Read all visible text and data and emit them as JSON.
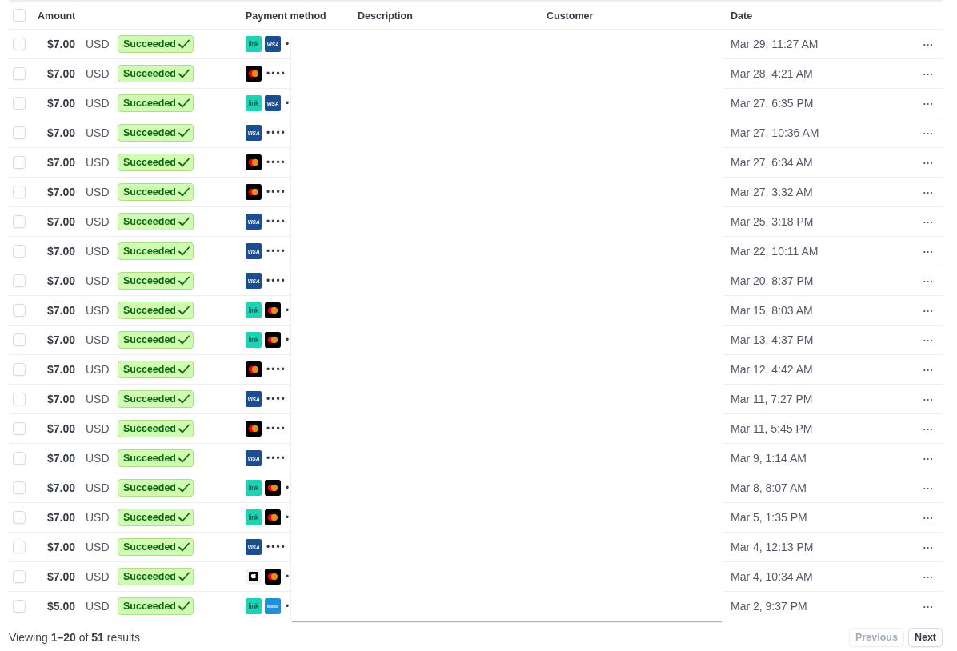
{
  "table": {
    "columns": [
      {
        "label": "Amount"
      },
      {
        "label": "Payment method"
      },
      {
        "label": "Description"
      },
      {
        "label": "Customer"
      },
      {
        "label": "Date"
      }
    ],
    "header_checkbox": {
      "checked": false
    },
    "rows": [
      {
        "checked": false,
        "amount": "$7.00",
        "currency": "USD",
        "status": "Succeeded",
        "methods": [
          {
            "kind": "link",
            "label": "link"
          },
          {
            "kind": "visa",
            "label": "VISA"
          }
        ],
        "masked": "•",
        "date": "Mar 29, 11:27 AM",
        "more": "···"
      },
      {
        "checked": false,
        "amount": "$7.00",
        "currency": "USD",
        "status": "Succeeded",
        "methods": [
          {
            "kind": "mastercard"
          }
        ],
        "masked": "••••",
        "date": "Mar 28, 4:21 AM",
        "more": "···"
      },
      {
        "checked": false,
        "amount": "$7.00",
        "currency": "USD",
        "status": "Succeeded",
        "methods": [
          {
            "kind": "link",
            "label": "link"
          },
          {
            "kind": "visa",
            "label": "VISA"
          }
        ],
        "masked": "•",
        "date": "Mar 27, 6:35 PM",
        "more": "···"
      },
      {
        "checked": false,
        "amount": "$7.00",
        "currency": "USD",
        "status": "Succeeded",
        "methods": [
          {
            "kind": "visa",
            "label": "VISA"
          }
        ],
        "masked": "••••",
        "date": "Mar 27, 10:36 AM",
        "more": "···"
      },
      {
        "checked": false,
        "amount": "$7.00",
        "currency": "USD",
        "status": "Succeeded",
        "methods": [
          {
            "kind": "mastercard"
          }
        ],
        "masked": "••••",
        "date": "Mar 27, 6:34 AM",
        "more": "···"
      },
      {
        "checked": false,
        "amount": "$7.00",
        "currency": "USD",
        "status": "Succeeded",
        "methods": [
          {
            "kind": "mastercard"
          }
        ],
        "masked": "••••",
        "date": "Mar 27, 3:32 AM",
        "more": "···"
      },
      {
        "checked": false,
        "amount": "$7.00",
        "currency": "USD",
        "status": "Succeeded",
        "methods": [
          {
            "kind": "visa",
            "label": "VISA"
          }
        ],
        "masked": "••••",
        "date": "Mar 25, 3:18 PM",
        "more": "···"
      },
      {
        "checked": false,
        "amount": "$7.00",
        "currency": "USD",
        "status": "Succeeded",
        "methods": [
          {
            "kind": "visa",
            "label": "VISA"
          }
        ],
        "masked": "••••",
        "date": "Mar 22, 10:11 AM",
        "more": "···"
      },
      {
        "checked": false,
        "amount": "$7.00",
        "currency": "USD",
        "status": "Succeeded",
        "methods": [
          {
            "kind": "visa",
            "label": "VISA"
          }
        ],
        "masked": "••••",
        "date": "Mar 20, 8:37 PM",
        "more": "···"
      },
      {
        "checked": false,
        "amount": "$7.00",
        "currency": "USD",
        "status": "Succeeded",
        "methods": [
          {
            "kind": "link",
            "label": "link"
          },
          {
            "kind": "mastercard"
          }
        ],
        "masked": "•",
        "date": "Mar 15, 8:03 AM",
        "more": "···"
      },
      {
        "checked": false,
        "amount": "$7.00",
        "currency": "USD",
        "status": "Succeeded",
        "methods": [
          {
            "kind": "link",
            "label": "link"
          },
          {
            "kind": "mastercard"
          }
        ],
        "masked": "•",
        "date": "Mar 13, 4:37 PM",
        "more": "···"
      },
      {
        "checked": false,
        "amount": "$7.00",
        "currency": "USD",
        "status": "Succeeded",
        "methods": [
          {
            "kind": "mastercard"
          }
        ],
        "masked": "••••",
        "date": "Mar 12, 4:42 AM",
        "more": "···"
      },
      {
        "checked": false,
        "amount": "$7.00",
        "currency": "USD",
        "status": "Succeeded",
        "methods": [
          {
            "kind": "visa",
            "label": "VISA"
          }
        ],
        "masked": "••••",
        "date": "Mar 11, 7:27 PM",
        "more": "···"
      },
      {
        "checked": false,
        "amount": "$7.00",
        "currency": "USD",
        "status": "Succeeded",
        "methods": [
          {
            "kind": "mastercard"
          }
        ],
        "masked": "••••",
        "date": "Mar 11, 5:45 PM",
        "more": "···"
      },
      {
        "checked": false,
        "amount": "$7.00",
        "currency": "USD",
        "status": "Succeeded",
        "methods": [
          {
            "kind": "visa",
            "label": "VISA"
          }
        ],
        "masked": "••••",
        "date": "Mar 9, 1:14 AM",
        "more": "···"
      },
      {
        "checked": false,
        "amount": "$7.00",
        "currency": "USD",
        "status": "Succeeded",
        "methods": [
          {
            "kind": "link",
            "label": "link"
          },
          {
            "kind": "mastercard"
          }
        ],
        "masked": "•",
        "date": "Mar 8, 8:07 AM",
        "more": "···"
      },
      {
        "checked": false,
        "amount": "$7.00",
        "currency": "USD",
        "status": "Succeeded",
        "methods": [
          {
            "kind": "link",
            "label": "link"
          },
          {
            "kind": "mastercard"
          }
        ],
        "masked": "•",
        "date": "Mar 5, 1:35 PM",
        "more": "···"
      },
      {
        "checked": false,
        "amount": "$7.00",
        "currency": "USD",
        "status": "Succeeded",
        "methods": [
          {
            "kind": "visa",
            "label": "VISA"
          }
        ],
        "masked": "••••",
        "date": "Mar 4, 12:13 PM",
        "more": "···"
      },
      {
        "checked": false,
        "amount": "$7.00",
        "currency": "USD",
        "status": "Succeeded",
        "methods": [
          {
            "kind": "apple_pay"
          },
          {
            "kind": "mastercard"
          }
        ],
        "masked": "•",
        "date": "Mar 4, 10:34 AM",
        "more": "···"
      },
      {
        "checked": false,
        "amount": "$5.00",
        "currency": "USD",
        "status": "Succeeded",
        "methods": [
          {
            "kind": "link",
            "label": "link"
          },
          {
            "kind": "amex"
          }
        ],
        "masked": "•",
        "date": "Mar 2, 9:37 PM",
        "more": "···"
      }
    ]
  },
  "footer": {
    "summary": "Viewing **1–20** of **51** results",
    "buttons": [
      {
        "label": "Previous",
        "disabled": true
      },
      {
        "label": "Next",
        "disabled": false
      }
    ]
  }
}
